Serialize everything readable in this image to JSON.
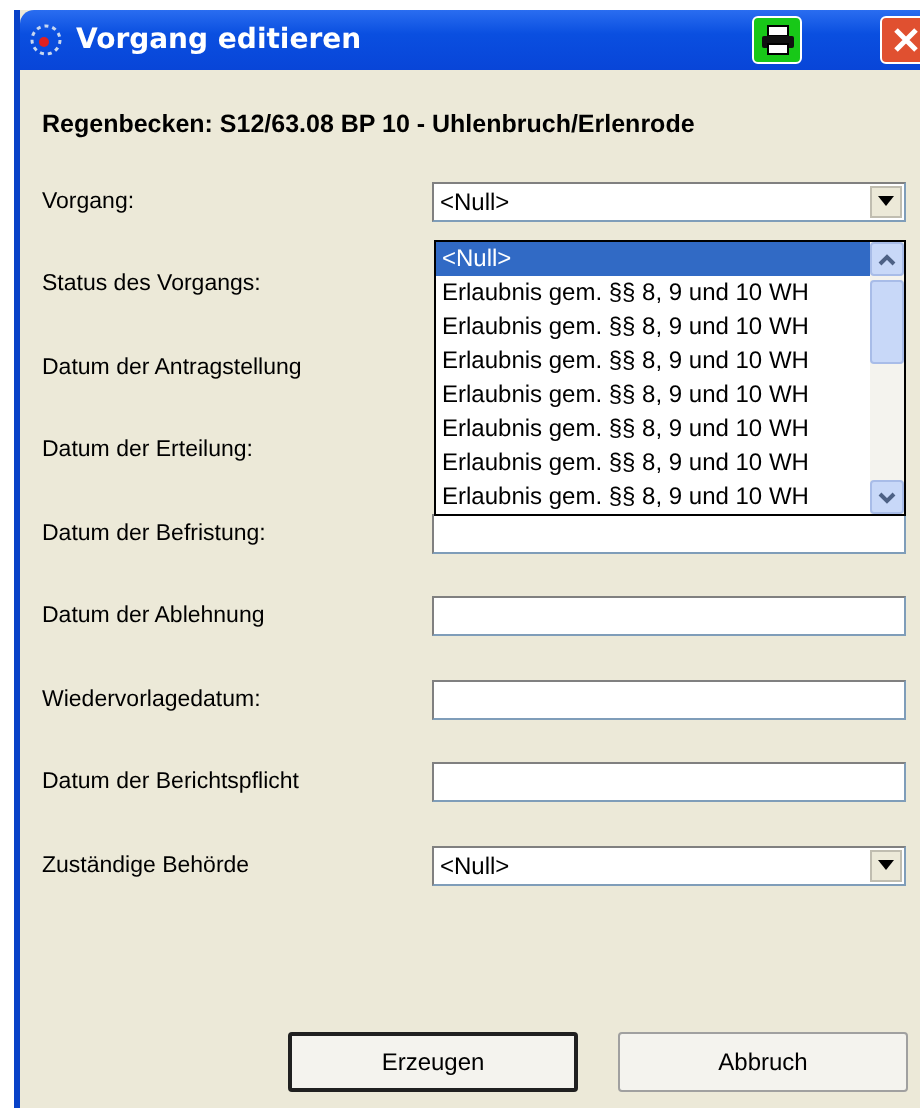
{
  "window": {
    "title": "Vorgang editieren"
  },
  "heading": "Regenbecken: S12/63.08 BP 10 - Uhlenbruch/Erlenrode",
  "rows": [
    {
      "label": "Vorgang:",
      "field": {
        "kind": "dropdown",
        "value": "<Null>"
      }
    },
    {
      "label": "Status des Vorgangs:"
    },
    {
      "label": "Datum der Antragstellung"
    },
    {
      "label": "Datum der Erteilung:"
    },
    {
      "label": "Datum der Befristung:",
      "field": {
        "kind": "text"
      }
    },
    {
      "label": "Datum der Ablehnung",
      "field": {
        "kind": "text"
      }
    },
    {
      "label": "Wiedervorlagedatum:",
      "field": {
        "kind": "text"
      }
    },
    {
      "label": "Datum der Berichtspflicht",
      "field": {
        "kind": "text"
      }
    },
    {
      "label": "Zuständige Behörde",
      "field": {
        "kind": "dropdown",
        "value": "<Null>"
      }
    }
  ],
  "dropdown_list": [
    {
      "label": "<Null>",
      "selected": true
    },
    {
      "label": "Erlaubnis gem. §§ 8, 9 und 10 WH",
      "selected": false
    },
    {
      "label": "Erlaubnis gem. §§ 8, 9 und 10 WH",
      "selected": false
    },
    {
      "label": "Erlaubnis gem. §§ 8, 9 und 10 WH",
      "selected": false
    },
    {
      "label": "Erlaubnis gem. §§ 8, 9 und 10 WH",
      "selected": false
    },
    {
      "label": "Erlaubnis gem. §§ 8, 9 und 10 WH",
      "selected": false
    },
    {
      "label": "Erlaubnis gem. §§ 8, 9 und 10 WH",
      "selected": false
    },
    {
      "label": "Erlaubnis gem. §§ 8, 9 und 10 WH",
      "selected": false
    }
  ],
  "buttons": [
    {
      "label": "Erzeugen",
      "default": true
    },
    {
      "label": "Abbruch",
      "default": false
    }
  ]
}
